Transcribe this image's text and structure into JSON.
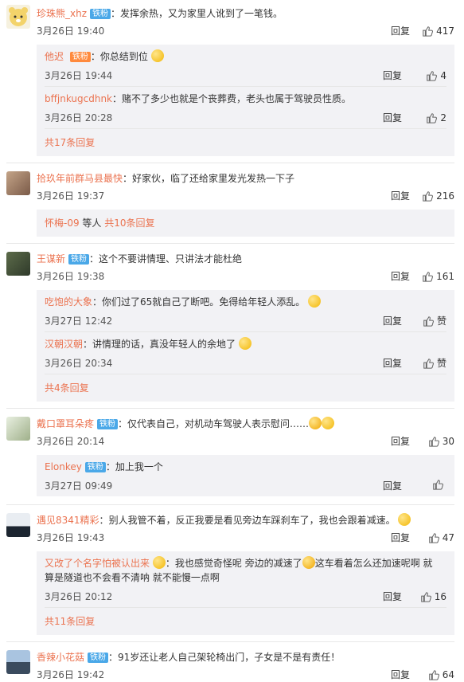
{
  "comments": [
    {
      "user": "珍珠熊_xhz",
      "badge": "铁粉",
      "text": "发挥余热，又为家里人讹到了一笔钱。",
      "time": "3月26日 19:40",
      "reply": "回复",
      "likes": "417",
      "replies": [
        {
          "user": "他迟",
          "badge": "铁粉",
          "text": "你总结到位",
          "time": "3月26日 19:44",
          "reply": "回复",
          "likes": "4"
        },
        {
          "user": "bffjnkugcdhnk",
          "text": "赌不了多少也就是个丧葬费，老头也属于驾驶员性质。",
          "time": "3月26日 20:28",
          "reply": "回复",
          "likes": "2"
        }
      ],
      "more": "共17条回复"
    },
    {
      "user": "拾玖年前群马县最快",
      "text": "好家伙，临了还给家里发光发热一下子",
      "time": "3月26日 19:37",
      "reply": "回复",
      "likes": "216",
      "more_prefix": "怀梅-09",
      "more_mid": " 等人 ",
      "more": "共10条回复"
    },
    {
      "user": "王谋新",
      "badge": "铁粉",
      "text": "这个不要讲情理、只讲法才能杜绝",
      "time": "3月26日 19:38",
      "reply": "回复",
      "likes": "161",
      "replies": [
        {
          "user": "吃饱的大象",
          "text": "你们过了65就自己了断吧。免得给年轻人添乱。",
          "time": "3月27日 12:42",
          "reply": "回复",
          "likes": "赞"
        },
        {
          "user": "汉朝汉朝",
          "text": "讲情理的话，真没年轻人的余地了",
          "time": "3月26日 20:34",
          "reply": "回复",
          "likes": "赞"
        }
      ],
      "more": "共4条回复"
    },
    {
      "user": "戴口罩耳朵疼",
      "badge": "铁粉",
      "text": "仅代表自己，对机动车驾驶人表示慰问……",
      "time": "3月26日 20:14",
      "reply": "回复",
      "likes": "30",
      "replies": [
        {
          "user": "Elonkey",
          "badge": "铁粉",
          "text": "加上我一个",
          "time": "3月27日 09:49",
          "reply": "回复",
          "likes": ""
        }
      ]
    },
    {
      "user": "遇见8341精彩",
      "text": "别人我管不着，反正我要是看见旁边车踩刹车了，我也会跟着减速。",
      "time": "3月26日 19:43",
      "reply": "回复",
      "likes": "47",
      "replies": [
        {
          "user": "又改了个名字怕被认出来",
          "text": "我也感觉奇怪呢 旁边的减速了",
          "text2": "这车看着怎么还加速呢啊 就",
          "text3": "算是隧道也不会看不清呐 就不能慢一点啊",
          "time": "3月26日 20:12",
          "reply": "回复",
          "likes": "16"
        }
      ],
      "more": "共11条回复"
    },
    {
      "user": "香辣小花菇",
      "badge": "铁粉",
      "text": "91岁还让老人自己架轮椅出门，子女是不是有责任！",
      "time": "3月26日 19:42",
      "reply": "回复",
      "likes": "64"
    }
  ],
  "colors": {
    "username": "#eb7350",
    "badge": "#4aa8e8",
    "subbg": "#f2f2f5"
  }
}
